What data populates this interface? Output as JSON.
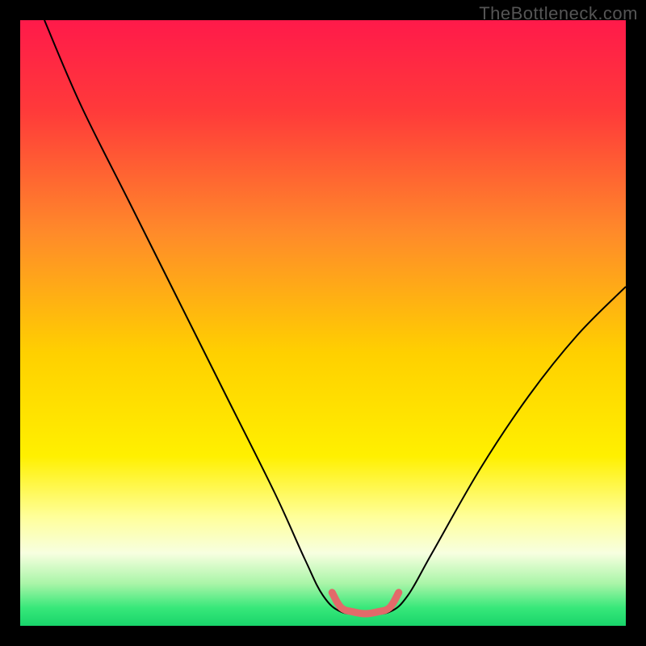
{
  "watermark": "TheBottleneck.com",
  "chart_data": {
    "type": "line",
    "title": "",
    "xlabel": "",
    "ylabel": "",
    "xlim": [
      0,
      100
    ],
    "ylim": [
      0,
      100
    ],
    "background_gradient": {
      "orientation": "vertical",
      "stops": [
        {
          "pos": 0.0,
          "color": "#ff1a4a"
        },
        {
          "pos": 0.15,
          "color": "#ff3a3a"
        },
        {
          "pos": 0.35,
          "color": "#ff8a2a"
        },
        {
          "pos": 0.55,
          "color": "#ffd000"
        },
        {
          "pos": 0.72,
          "color": "#fff000"
        },
        {
          "pos": 0.82,
          "color": "#ffff9a"
        },
        {
          "pos": 0.88,
          "color": "#f7ffe0"
        },
        {
          "pos": 0.93,
          "color": "#aaf5a8"
        },
        {
          "pos": 0.97,
          "color": "#38e87a"
        },
        {
          "pos": 1.0,
          "color": "#18d46a"
        }
      ]
    },
    "series": [
      {
        "name": "bottleneck-curve",
        "stroke": "#000000",
        "stroke_width": 2,
        "points": [
          {
            "x": 4,
            "y": 100
          },
          {
            "x": 10,
            "y": 86
          },
          {
            "x": 18,
            "y": 70
          },
          {
            "x": 26,
            "y": 54
          },
          {
            "x": 34,
            "y": 38
          },
          {
            "x": 42,
            "y": 22
          },
          {
            "x": 47,
            "y": 11
          },
          {
            "x": 50,
            "y": 5
          },
          {
            "x": 53,
            "y": 2.3
          },
          {
            "x": 57,
            "y": 2.0
          },
          {
            "x": 61,
            "y": 2.3
          },
          {
            "x": 64,
            "y": 5
          },
          {
            "x": 68,
            "y": 12
          },
          {
            "x": 76,
            "y": 26
          },
          {
            "x": 84,
            "y": 38
          },
          {
            "x": 92,
            "y": 48
          },
          {
            "x": 100,
            "y": 56
          }
        ]
      },
      {
        "name": "optimal-band",
        "stroke": "#e26a6a",
        "stroke_width": 9,
        "linecap": "round",
        "points": [
          {
            "x": 51.5,
            "y": 5.5
          },
          {
            "x": 53,
            "y": 3.0
          },
          {
            "x": 55,
            "y": 2.3
          },
          {
            "x": 57,
            "y": 2.0
          },
          {
            "x": 59,
            "y": 2.3
          },
          {
            "x": 61,
            "y": 3.0
          },
          {
            "x": 62.5,
            "y": 5.5
          }
        ]
      }
    ]
  }
}
